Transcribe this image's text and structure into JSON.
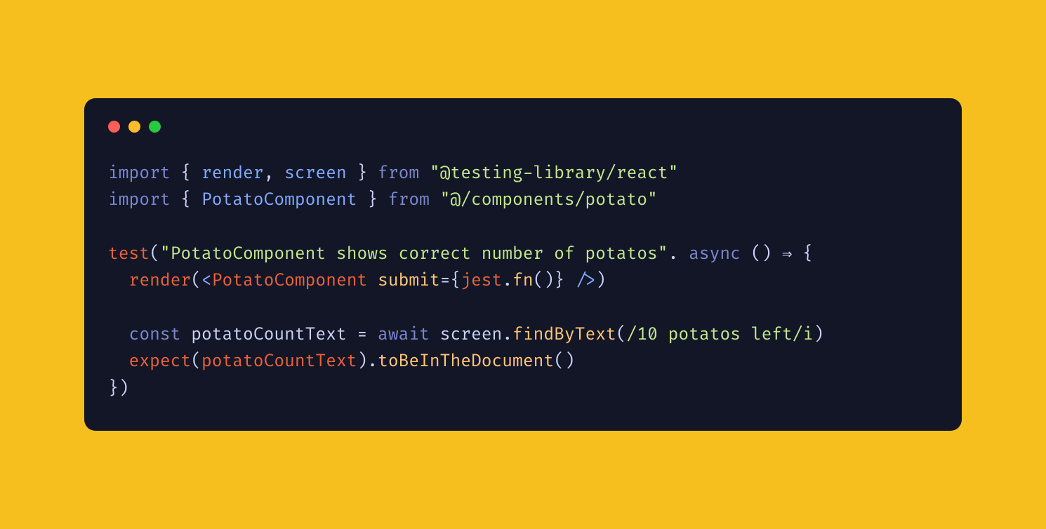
{
  "code": {
    "line1": {
      "import": "import",
      "brace_open": " { ",
      "render": "render",
      "comma": ", ",
      "screen": "screen",
      "brace_close": " } ",
      "from": "from",
      "space": " ",
      "string": "\"@testing-library/react\""
    },
    "line2": {
      "import": "import",
      "brace_open": " { ",
      "component": "PotatoComponent",
      "brace_close": " } ",
      "from": "from",
      "space": " ",
      "string": "\"@/components/potato\""
    },
    "line4": {
      "test": "test",
      "paren_open": "(",
      "string": "\"PotatoComponent shows correct number of potatos\"",
      "dot": ". ",
      "async": "async",
      "arrow": " () ⇒ {"
    },
    "line5": {
      "indent": "  ",
      "render": "render",
      "paren_open": "(",
      "lt": "<",
      "component": "PotatoComponent",
      "space": " ",
      "attr": "submit",
      "eq": "=",
      "brace_open": "{",
      "jest": "jest",
      "dot": ".",
      "fn": "fn",
      "parens": "()",
      "brace_close": "}",
      "selfclose": " />",
      "paren_close": ")"
    },
    "line7": {
      "indent": "  ",
      "const": "const",
      "space": " ",
      "varname": "potatoCountText",
      "eq": " = ",
      "await": "await",
      "space2": " ",
      "screen": "screen",
      "dot": ".",
      "method": "findByText",
      "paren_open": "(",
      "regex": "/10 potatos left/i",
      "paren_close": ")"
    },
    "line8": {
      "indent": "  ",
      "expect": "expect",
      "paren_open": "(",
      "varname": "potatoCountText",
      "paren_close": ")",
      "dot": ".",
      "method": "toBeInTheDocument",
      "parens": "()"
    },
    "line9": {
      "close": "})"
    }
  }
}
